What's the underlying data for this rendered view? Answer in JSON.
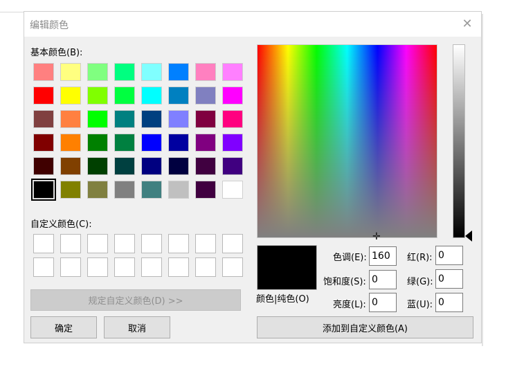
{
  "dialog": {
    "title": "编辑颜色",
    "close_symbol": "✕"
  },
  "basic_colors": {
    "label": "基本颜色(B):",
    "selected_index": 40,
    "swatches": [
      "#ff8080",
      "#ffff80",
      "#80ff80",
      "#00ff80",
      "#80ffff",
      "#0080ff",
      "#ff80c0",
      "#ff80ff",
      "#ff0000",
      "#ffff00",
      "#80ff00",
      "#00ff40",
      "#00ffff",
      "#0080c0",
      "#8080c0",
      "#ff00ff",
      "#804040",
      "#ff8040",
      "#00ff00",
      "#008080",
      "#004080",
      "#8080ff",
      "#800040",
      "#ff0080",
      "#800000",
      "#ff8000",
      "#008000",
      "#008040",
      "#0000ff",
      "#0000a0",
      "#800080",
      "#8000ff",
      "#400000",
      "#804000",
      "#004000",
      "#004040",
      "#000080",
      "#000040",
      "#400040",
      "#400080",
      "#000000",
      "#808000",
      "#808040",
      "#808080",
      "#408080",
      "#c0c0c0",
      "#400040",
      "#ffffff"
    ]
  },
  "custom_colors": {
    "label": "自定义颜色(C):",
    "count": 16
  },
  "buttons": {
    "define_custom": "规定自定义颜色(D) >>",
    "ok": "确定",
    "cancel": "取消",
    "add_custom": "添加到自定义颜色(A)"
  },
  "preview": {
    "label": "颜色|纯色(O)",
    "color": "#000000"
  },
  "fields": {
    "hue_label": "色调(E):",
    "hue_value": "160",
    "sat_label": "饱和度(S):",
    "sat_value": "0",
    "lum_label": "亮度(L):",
    "lum_value": "0",
    "red_label": "红(R):",
    "red_value": "0",
    "green_label": "绿(G):",
    "green_value": "0",
    "blue_label": "蓝(U):",
    "blue_value": "0"
  },
  "icons": {
    "close": "close-icon",
    "crosshair": "crosshair-icon",
    "luminance_pointer": "triangle-left-icon"
  }
}
